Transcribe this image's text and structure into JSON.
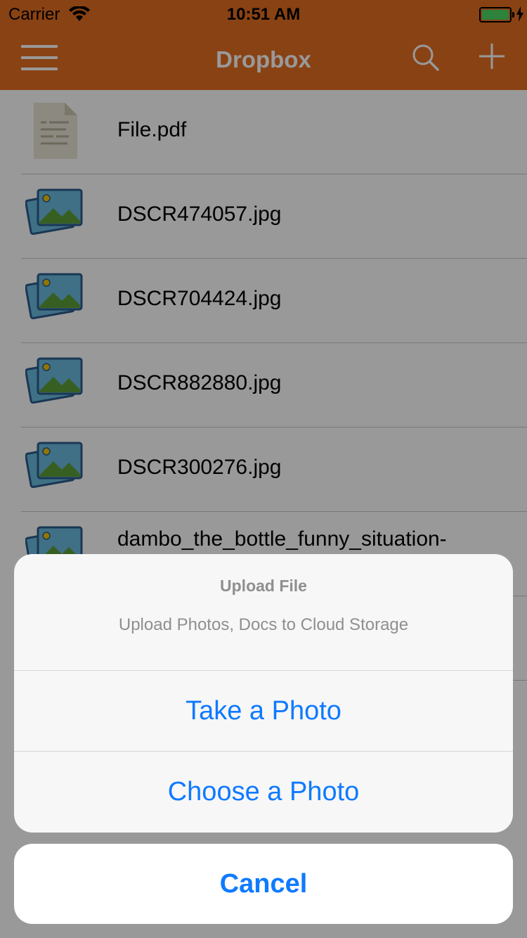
{
  "status_bar": {
    "carrier": "Carrier",
    "time": "10:51 AM"
  },
  "nav": {
    "title": "Dropbox"
  },
  "files": [
    {
      "name": "File.pdf",
      "icon": "document-icon"
    },
    {
      "name": "DSCR474057.jpg",
      "icon": "image-icon"
    },
    {
      "name": "DSCR704424.jpg",
      "icon": "image-icon"
    },
    {
      "name": "DSCR882880.jpg",
      "icon": "image-icon"
    },
    {
      "name": "DSCR300276.jpg",
      "icon": "image-icon"
    },
    {
      "name": "dambo_the_bottle_funny_situation-",
      "icon": "image-icon"
    },
    {
      "name": "",
      "icon": "image-icon"
    }
  ],
  "action_sheet": {
    "title": "Upload File",
    "message": "Upload Photos, Docs to Cloud Storage",
    "take_photo": "Take a Photo",
    "choose_photo": "Choose a Photo",
    "cancel": "Cancel"
  },
  "colors": {
    "nav": "#e56f22",
    "action": "#0f7aff",
    "battery": "#4cd964"
  }
}
